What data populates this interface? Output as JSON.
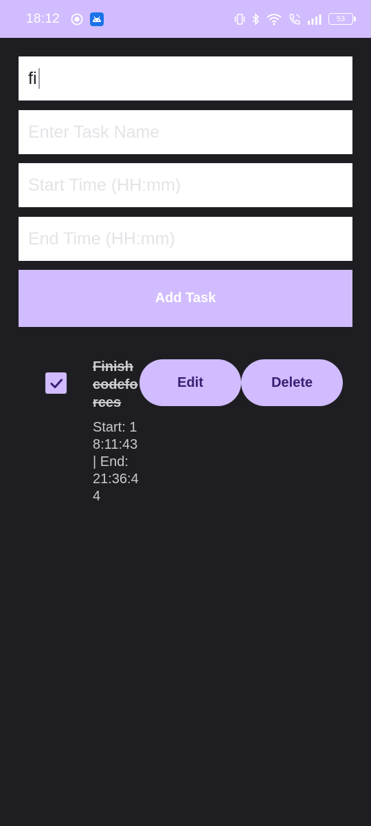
{
  "status_bar": {
    "time": "18:12",
    "battery_level": "53",
    "icons": [
      "record-icon",
      "android-app-icon",
      "vibrate-icon",
      "bluetooth-icon",
      "wifi-icon",
      "wifi-call-icon",
      "signal-icon",
      "battery-icon"
    ]
  },
  "form": {
    "search_value": "fi",
    "task_name_placeholder": "Enter Task Name",
    "start_time_placeholder": "Start Time (HH:mm)",
    "end_time_placeholder": "End Time (HH:mm)",
    "add_button_label": "Add Task"
  },
  "tasks": [
    {
      "name": "Finish codeforces",
      "checked": true,
      "time_text": "Start: 18:11:43 | End: 21:36:44",
      "edit_label": "Edit",
      "delete_label": "Delete"
    }
  ],
  "colors": {
    "accent": "#d0bcfe",
    "background": "#1e1e22",
    "button_text": "#381e72"
  }
}
